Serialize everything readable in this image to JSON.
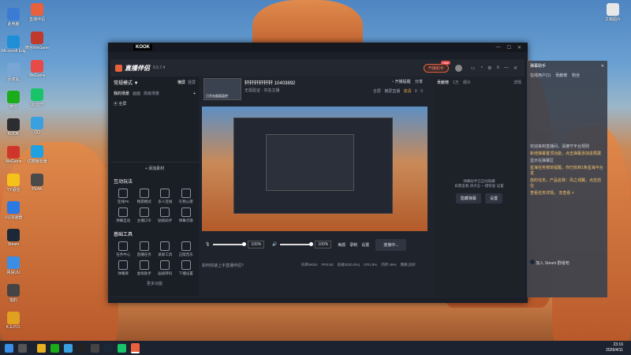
{
  "desktop": {
    "icons_left": [
      {
        "label": "此电脑",
        "color": "#3b7bd4"
      },
      {
        "label": "Microsoft Edge",
        "color": "#1e8fd6"
      },
      {
        "label": "回收站",
        "color": "#7aa6d6"
      },
      {
        "label": "微信",
        "color": "#1aad19"
      },
      {
        "label": "KOOK",
        "color": "#2b2d31"
      },
      {
        "label": "WeGame",
        "color": "#d0352b"
      },
      {
        "label": "YY语音",
        "color": "#f4c21a"
      },
      {
        "label": "UU加速器",
        "color": "#2a79e5"
      },
      {
        "label": "Steam",
        "color": "#1b2838"
      },
      {
        "label": "网易UU",
        "color": "#3a8ee6"
      },
      {
        "label": "猎豹",
        "color": "#444444"
      },
      {
        "label": "K.E.P.D.",
        "color": "#e0a020"
      }
    ],
    "icons_col2": [
      {
        "label": "直播伴侣",
        "color": "#e8603c"
      },
      {
        "label": "微信WeGame",
        "color": "#c0392b"
      },
      {
        "label": "WeGame",
        "color": "#e84a4a"
      },
      {
        "label": "QQ音乐",
        "color": "#19c36a"
      },
      {
        "label": "QQ",
        "color": "#3aa0e0"
      },
      {
        "label": "优酷播放器",
        "color": "#1fa0e0"
      },
      {
        "label": "PEAK",
        "color": "#4a4a4a"
      }
    ],
    "top_right_icon": "文稿图片"
  },
  "taskbar": {
    "time": "23:16",
    "date": "2026/4/11"
  },
  "outer_window": {
    "logo": "KOOK"
  },
  "app": {
    "logo": "直播伴侣",
    "version": "6.5.7.4",
    "start_live_label": "开播助手",
    "new_badge": "new",
    "header_icons": [
      "chat-icon",
      "bell-icon",
      "gear-icon",
      "menu-icon"
    ]
  },
  "left_panel": {
    "mode": "常规模式 ▼",
    "tab_landscape": "横屏",
    "tab_portrait": "竖屏",
    "scene_tabs": [
      "我的场景",
      "画面",
      "高级场景"
    ],
    "add_icon": "+",
    "scene_item": "全屏",
    "add_material": "+ 添加素材",
    "section_interact": "互动玩法",
    "interact_items": [
      "连线PK",
      "畅游模式",
      "多人连线",
      "礼物心愿",
      "弹幕互动",
      "主播口令",
      "贴纸助手",
      "弹幕点歌"
    ],
    "section_basic": "基础工具",
    "basic_items": [
      "任务中心",
      "直播任务",
      "录屏工具",
      "正版音乐",
      "弹幕库",
      "虚拟助手",
      "画质转码",
      "下播设置"
    ],
    "more": "更多功能"
  },
  "center": {
    "room_name": "轩轩轩轩轩轩 10403892",
    "sub1": "无需验证",
    "sub2": "实名主播",
    "actions": [
      "开播提醒",
      "分享"
    ],
    "toolbar": [
      "全屏",
      "横屏直播",
      "高清"
    ],
    "counters": [
      "0",
      "0"
    ],
    "thumb_caption": "已开启画面监控",
    "mic_label": "麦克风",
    "mic_pct": "100%",
    "speaker_label": "扬声器",
    "speaker_pct": "100%",
    "bottom_icons": [
      "美颜",
      "录制",
      "设置"
    ],
    "connect_button": "连接中...",
    "status_left": "如何快速上手直播伴侣?",
    "status_stats": [
      "码率0Kb/s",
      "FPS:60",
      "丢帧0/0(0.0%)",
      "CPU:8%",
      "内存:48%",
      "网络:良好"
    ]
  },
  "right_panel": {
    "tabs": [
      "贡献榜",
      "1万",
      "观众"
    ],
    "pill_label": "详情",
    "tip_line1": "弹幕助手已自动隐藏",
    "tip_line2": "如需查看,请点击 一键恢复 设置",
    "buttons": [
      "隐藏弹幕",
      "设置"
    ]
  },
  "chat_window": {
    "title": "弹幕助手",
    "tabs": [
      "在线用户(1)",
      "贡献榜",
      "粉丝"
    ],
    "lines": [
      {
        "text": "欢迎来到直播间，请遵守平台规则",
        "hl": false
      },
      {
        "text": "新增弹幕置顶功能，点击弹幕添加进再展",
        "hl": true
      },
      {
        "text": "显示在弹幕区",
        "hl": false
      },
      {
        "text": "星海任务榜单提醒，你已收到1条星海平台发",
        "hl": true
      },
      {
        "text": "放的任务，产品名称：风之翎翼，点击前往",
        "hl": true
      },
      {
        "text": "查看任务详情。 去查看 >",
        "hl": true
      }
    ],
    "footer": "加入 Steam 群组吧"
  }
}
